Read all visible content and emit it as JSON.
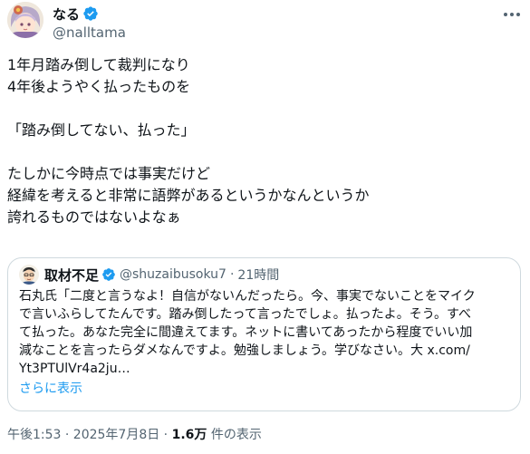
{
  "author": {
    "display_name": "なる",
    "handle": "@nalltama",
    "avatar_icon": "anime-character-avatar",
    "verified_icon": "verified-badge-icon"
  },
  "more_icon": "more-options-icon",
  "tweet": {
    "lines": [
      "1年月踏み倒して裁判になり",
      "4年後ようやく払ったものを",
      "",
      "「踏み倒してない、払った」",
      "",
      "たしかに今時点では事実だけど",
      "経緯を考えると非常に語弊があるというかなんというか",
      "誇れるものではないよなぁ"
    ]
  },
  "quote": {
    "display_name": "取材不足",
    "handle": "@shuzaibusoku7",
    "separator": "·",
    "time": "21時間",
    "avatar_icon": "cartoon-man-avatar",
    "verified_icon": "verified-badge-icon",
    "lines": [
      "石丸氏「二度と言うなよ！自信がないんだったら。今、事実でないことをマイク",
      "で言いふらしてたんです。踏み倒したって言ったでしょ。払ったよ。そう。すべ",
      "て払った。あなた完全に間違えてます。ネットに書いてあったから程度でいい加",
      "減なことを言ったらダメなんですよ。勉強しましょう。学びなさい。大 x.com/",
      "Yt3PTUlVr4a2ju…"
    ],
    "show_more": "さらに表示"
  },
  "meta": {
    "time": "午後1:53 · 2025年7月8日",
    "separator": " · ",
    "views_count": "1.6万",
    "views_label": " 件の表示"
  },
  "colors": {
    "text": "#0f1419",
    "secondary": "#536471",
    "accent": "#1d9bf0",
    "border": "#cfd9de"
  }
}
